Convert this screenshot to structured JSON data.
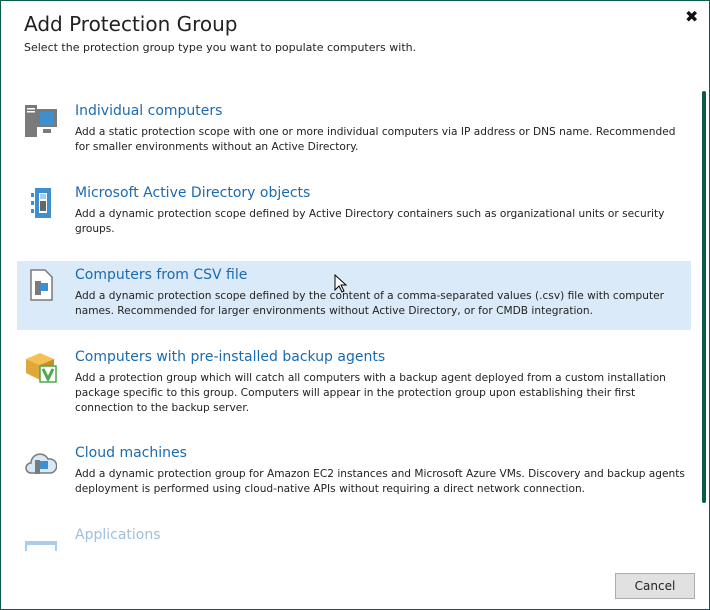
{
  "dialog": {
    "title": "Add Protection Group",
    "subtitle": "Select the protection group type you want to populate computers with.",
    "close_icon": "close-icon"
  },
  "items": [
    {
      "title": "Individual computers",
      "description": "Add a static protection scope with one or more individual computers via IP address or DNS name. Recommended for smaller environments without an Active Directory.",
      "icon": "computer-icon"
    },
    {
      "title": "Microsoft Active Directory objects",
      "description": "Add a dynamic protection scope defined by Active Directory containers such as organizational units or security groups.",
      "icon": "active-directory-icon"
    },
    {
      "title": "Computers from CSV file",
      "description": "Add a dynamic protection scope defined by the content of a comma-separated values (.csv) file with computer names. Recommended for larger environments without Active Directory, or for CMDB integration.",
      "icon": "csv-file-icon",
      "selected": true
    },
    {
      "title": "Computers with pre-installed backup agents",
      "description": "Add a protection group which will catch all computers with a backup agent deployed from a custom installation package specific to this group. Computers will appear in the protection group upon establishing their first connection to the backup server.",
      "icon": "package-icon"
    },
    {
      "title": "Cloud machines",
      "description": "Add a dynamic protection group for Amazon EC2 instances and Microsoft Azure VMs. Discovery and backup agents deployment is performed using cloud-native APIs without requiring a direct network connection.",
      "icon": "cloud-icon"
    },
    {
      "title": "Applications",
      "icon": "application-icon"
    }
  ],
  "footer": {
    "cancel_label": "Cancel"
  },
  "colors": {
    "accent": "#1a6ab0",
    "border": "#0b5b4a",
    "selected": "#dbeaf8"
  }
}
